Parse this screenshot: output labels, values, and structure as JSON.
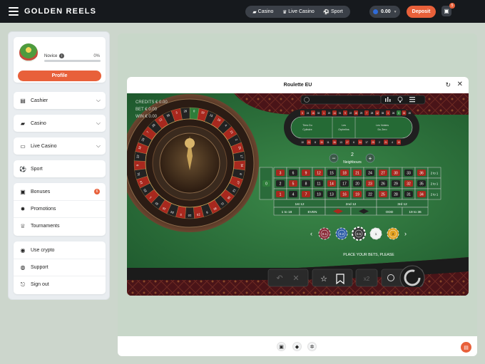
{
  "header": {
    "logo": "GOLDEN REELS",
    "nav": [
      {
        "icon": "casino-icon",
        "label": "Casino"
      },
      {
        "icon": "live-casino-icon",
        "label": "Live Casino"
      },
      {
        "icon": "sport-icon",
        "label": "Sport"
      }
    ],
    "balance": "0.00",
    "deposit_label": "Deposit",
    "gift_badge": "5"
  },
  "sidebar": {
    "profile": {
      "rank": "Novice",
      "progress_text": "0%",
      "progress_fraction": 0,
      "button": "Profile"
    },
    "groups": [
      {
        "icon": "cashier-icon",
        "label": "Cashier"
      },
      {
        "icon": "casino-icon",
        "label": "Casino"
      },
      {
        "icon": "live-casino-icon",
        "label": "Live Casino"
      },
      {
        "icon": "sport-icon",
        "label": "Sport"
      }
    ],
    "promos": [
      {
        "icon": "bonuses-icon",
        "label": "Bonuses",
        "badge": "6"
      },
      {
        "icon": "promotions-icon",
        "label": "Promotions"
      },
      {
        "icon": "tournaments-icon",
        "label": "Tournaments"
      }
    ],
    "misc": [
      {
        "icon": "crypto-icon",
        "label": "Use crypto"
      },
      {
        "icon": "support-icon",
        "label": "Support"
      },
      {
        "icon": "sign-out-icon",
        "label": "Sign out"
      }
    ]
  },
  "game": {
    "title": "Roulette EU",
    "credits": "CREDITS €  0.00",
    "bet": "BET €  0.00",
    "win": "WIN €  0.00",
    "neighbours_value": "2",
    "neighbours_label": "Neighbours",
    "racetrack_sections": [
      "Tiers Du Cylindre",
      "Les Orphelins",
      "Les Voisins Du Zero"
    ],
    "zero": "0",
    "grid_rows": [
      [
        "3",
        "6",
        "9",
        "12",
        "15",
        "18",
        "21",
        "24",
        "27",
        "30",
        "33",
        "36"
      ],
      [
        "2",
        "5",
        "8",
        "11",
        "14",
        "17",
        "20",
        "23",
        "26",
        "29",
        "32",
        "35"
      ],
      [
        "1",
        "4",
        "7",
        "10",
        "13",
        "16",
        "19",
        "22",
        "25",
        "28",
        "31",
        "34"
      ]
    ],
    "red_numbers": [
      "1",
      "3",
      "5",
      "7",
      "9",
      "12",
      "14",
      "16",
      "18",
      "19",
      "21",
      "23",
      "25",
      "27",
      "30",
      "32",
      "34",
      "36"
    ],
    "column_label": "2 to 1",
    "dozens": [
      "1st 12",
      "2nd 12",
      "3rd 12"
    ],
    "outside_bets": [
      "1 to 18",
      "EVEN",
      "",
      "",
      "ODD",
      "19 to 36"
    ],
    "chips": [
      "0.1",
      "0.2",
      "0.5",
      "1",
      "2"
    ],
    "selected_chip": "0.5",
    "status": "PLACE YOUR BETS, PLEASE",
    "double_label": "x2"
  },
  "colors": {
    "accent": "#e8603a",
    "felt": "#2a6b3a",
    "red": "#a8281e",
    "black": "#222"
  }
}
